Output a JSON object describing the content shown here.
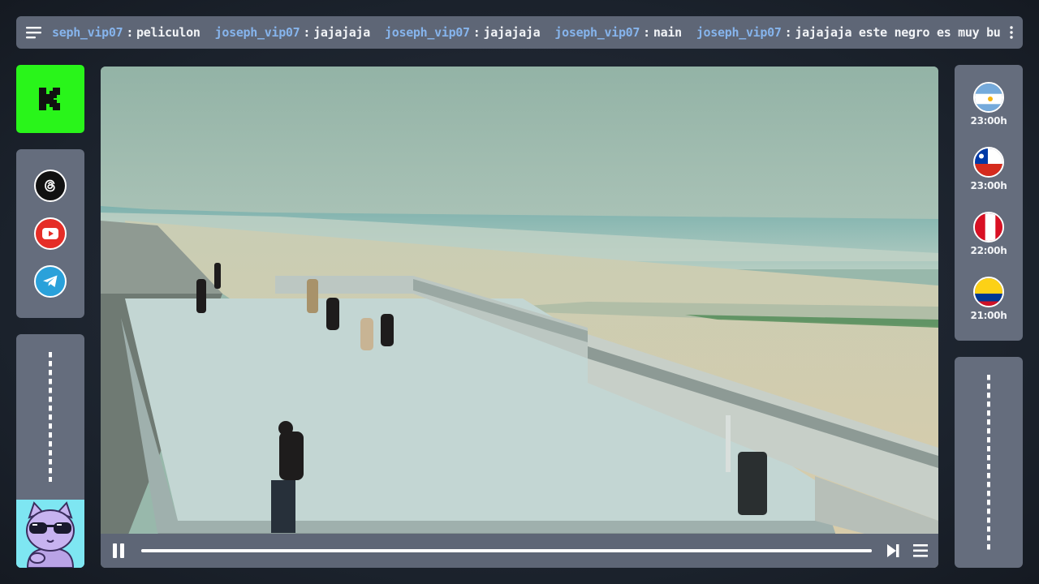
{
  "chat": {
    "messages": [
      {
        "user": "seph_vip07",
        "text": "peliculon"
      },
      {
        "user": "joseph_vip07",
        "text": "jajajaja"
      },
      {
        "user": "joseph_vip07",
        "text": "jajajaja"
      },
      {
        "user": "joseph_vip07",
        "text": "nain"
      },
      {
        "user": "joseph_vip07",
        "text": "jajajaja este negro es muy buena honda"
      }
    ],
    "separator": ":",
    "menu_icon": "hamburger-icon",
    "more_icon": "vertical-dots-icon"
  },
  "brand": {
    "icon": "kick-logo-icon",
    "color": "#29f51a"
  },
  "socials": [
    {
      "name": "threads",
      "icon": "threads-icon",
      "color": "#111111"
    },
    {
      "name": "youtube",
      "icon": "youtube-icon",
      "color": "#e52d27"
    },
    {
      "name": "telegram",
      "icon": "telegram-icon",
      "color": "#2aa1da"
    }
  ],
  "player": {
    "play_state_icon": "pause-icon",
    "next_icon": "skip-next-icon",
    "playlist_icon": "playlist-icon",
    "progress": 1.0
  },
  "schedule": [
    {
      "country": "Argentina",
      "flag_icon": "argentina-flag-icon",
      "time": "23:00h"
    },
    {
      "country": "Chile",
      "flag_icon": "chile-flag-icon",
      "time": "23:00h"
    },
    {
      "country": "Peru",
      "flag_icon": "peru-flag-icon",
      "time": "22:00h"
    },
    {
      "country": "Colombia",
      "flag_icon": "colombia-flag-icon",
      "time": "21:00h"
    }
  ],
  "colors": {
    "panel": "#656d7d",
    "username": "#86b4ec",
    "background": "#1e2530"
  }
}
